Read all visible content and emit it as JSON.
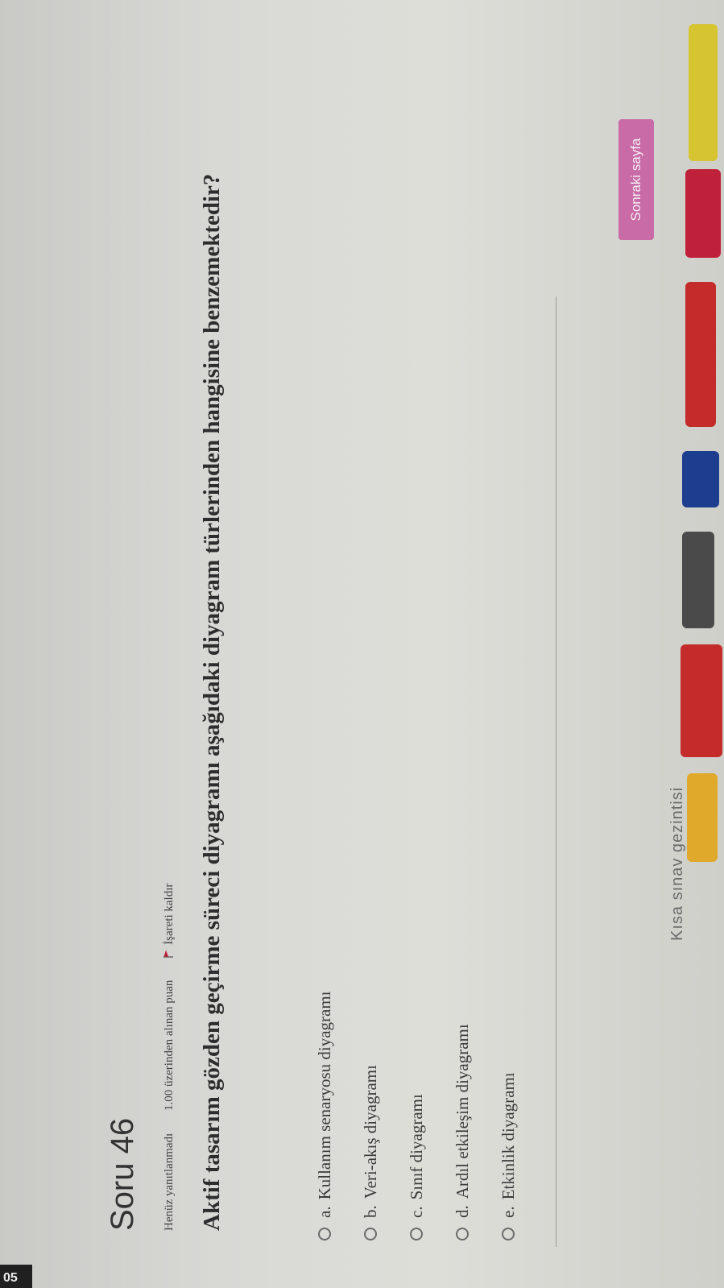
{
  "question": {
    "title": "Soru 46",
    "status": "Henüz yanıtlanmadı",
    "points": "1.00 üzerinden alınan puan",
    "flag_label": "İşareti kaldır",
    "text": "Aktif tasarım gözden geçirme süreci diyagramı aşağıdaki diyagram türlerinden hangisine benzemektedir?"
  },
  "answers": [
    {
      "letter": "a.",
      "text": "Kullanım senaryosu diyagramı"
    },
    {
      "letter": "b.",
      "text": "Veri-akış diyagramı"
    },
    {
      "letter": "c.",
      "text": "Sınıf diyagramı"
    },
    {
      "letter": "d.",
      "text": "Ardıl etkileşim diyagramı"
    },
    {
      "letter": "e.",
      "text": "Etkinlik diyagramı"
    }
  ],
  "navigation": {
    "next_button": "Sonraki sayfa",
    "quiz_navigation": "Kısa sınav gezintisi"
  },
  "screen": {
    "corner_text": "05"
  },
  "colors": {
    "accent": "#c96ba6",
    "flag": "#c0213a"
  },
  "icons": {
    "flag": "flag-icon",
    "radio": "radio-unchecked-icon"
  }
}
